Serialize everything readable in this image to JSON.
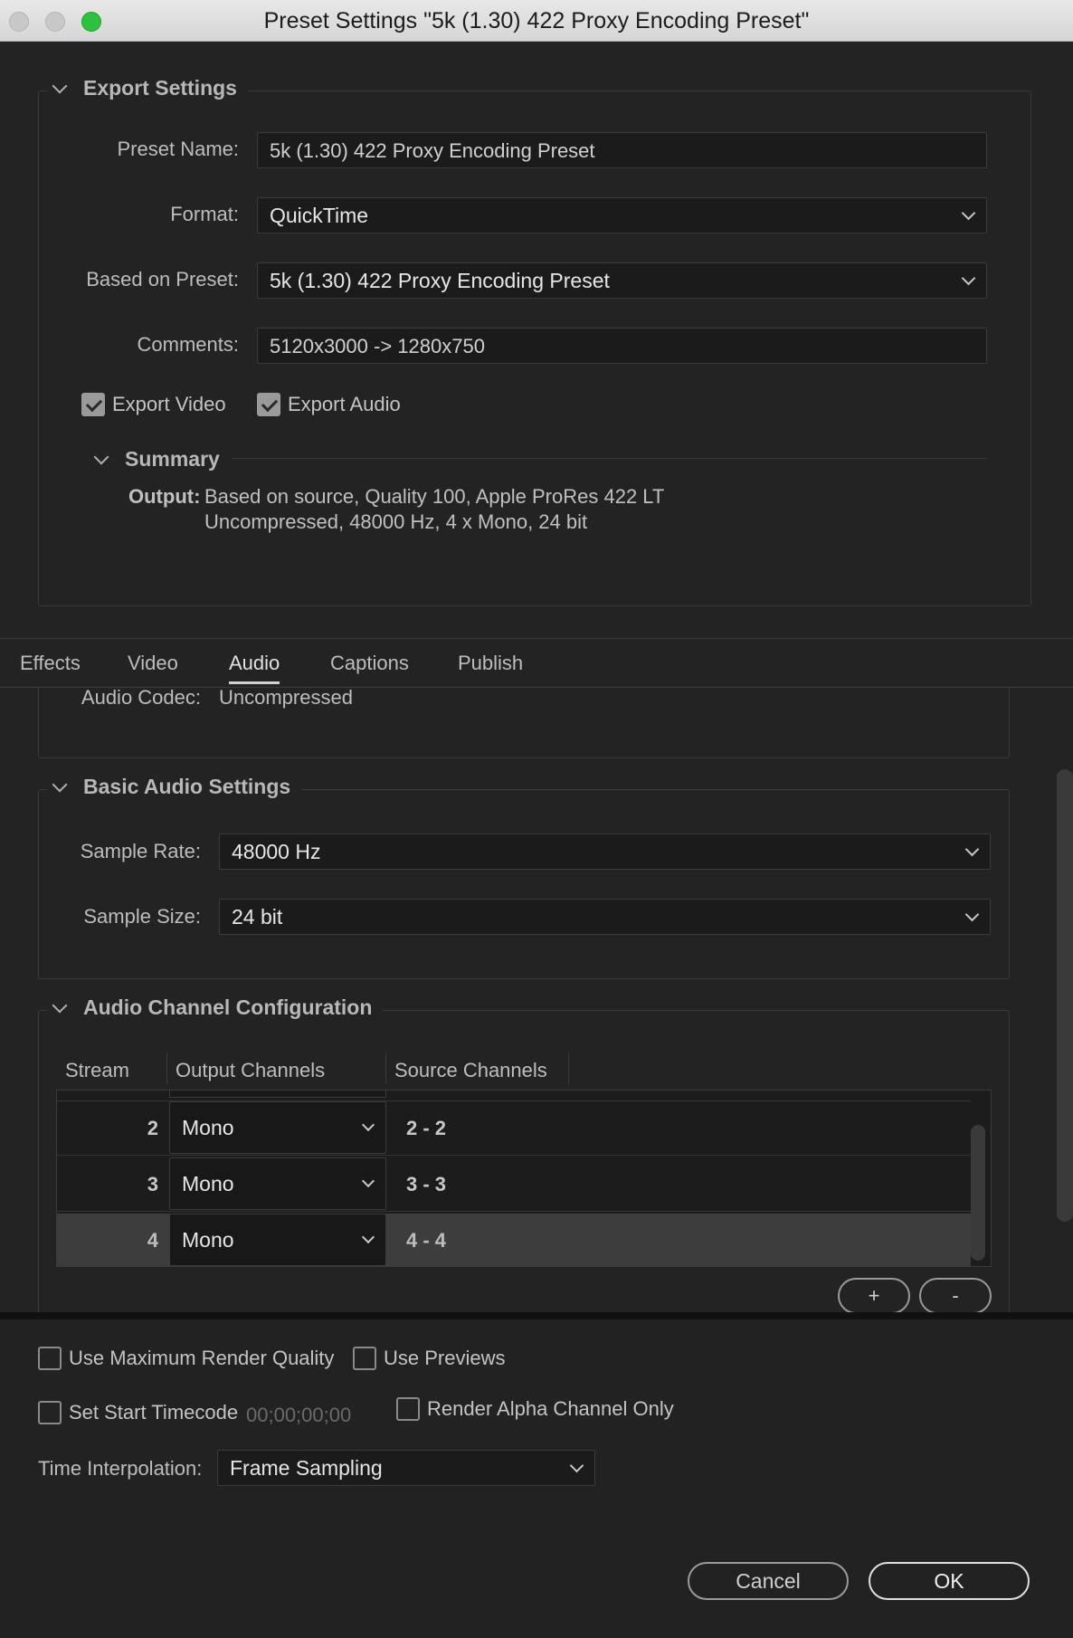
{
  "window": {
    "title": "Preset Settings \"5k (1.30) 422 Proxy Encoding Preset\""
  },
  "export_settings": {
    "heading": "Export Settings",
    "preset_name_label": "Preset Name:",
    "preset_name_value": "5k (1.30) 422 Proxy Encoding Preset",
    "format_label": "Format:",
    "format_value": "QuickTime",
    "based_on_label": "Based on Preset:",
    "based_on_value": "5k (1.30) 422 Proxy Encoding Preset",
    "comments_label": "Comments:",
    "comments_value": "5120x3000 -> 1280x750",
    "export_video_label": "Export Video",
    "export_video_checked": true,
    "export_audio_label": "Export Audio",
    "export_audio_checked": true
  },
  "summary": {
    "heading": "Summary",
    "output_label": "Output:",
    "output_line1": "Based on source, Quality 100, Apple ProRes 422 LT",
    "output_line2": "Uncompressed, 48000 Hz, 4 x Mono, 24 bit"
  },
  "tabs": [
    {
      "label": "Effects",
      "active": false
    },
    {
      "label": "Video",
      "active": false
    },
    {
      "label": "Audio",
      "active": true
    },
    {
      "label": "Captions",
      "active": false
    },
    {
      "label": "Publish",
      "active": false
    }
  ],
  "audio": {
    "codec_label": "Audio Codec:",
    "codec_value": "Uncompressed",
    "basic_heading": "Basic Audio Settings",
    "sample_rate_label": "Sample Rate:",
    "sample_rate_value": "48000 Hz",
    "sample_size_label": "Sample Size:",
    "sample_size_value": "24 bit",
    "channel_heading": "Audio Channel Configuration",
    "columns": [
      "Stream",
      "Output Channels",
      "Source Channels"
    ],
    "rows": [
      {
        "stream": "2",
        "output": "Mono",
        "source": "2 - 2",
        "selected": false
      },
      {
        "stream": "3",
        "output": "Mono",
        "source": "3 - 3",
        "selected": false
      },
      {
        "stream": "4",
        "output": "Mono",
        "source": "4 - 4",
        "selected": true
      }
    ],
    "add_label": "+",
    "remove_label": "-"
  },
  "render": {
    "max_quality_label": "Use Maximum Render Quality",
    "use_previews_label": "Use Previews",
    "start_timecode_label": "Set Start Timecode",
    "start_timecode_value": "00;00;00;00",
    "alpha_only_label": "Render Alpha Channel Only",
    "time_interp_label": "Time Interpolation:",
    "time_interp_value": "Frame Sampling"
  },
  "buttons": {
    "cancel": "Cancel",
    "ok": "OK"
  }
}
